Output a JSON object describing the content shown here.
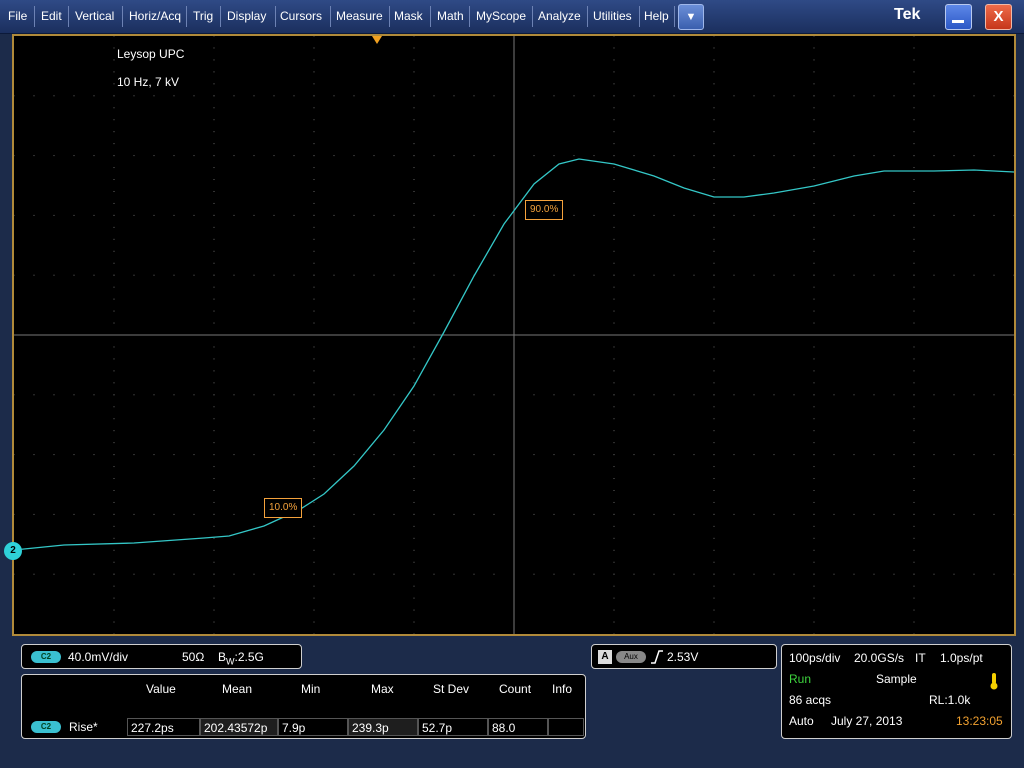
{
  "menu": {
    "items": [
      "File",
      "Edit",
      "Vertical",
      "Horiz/Acq",
      "Trig",
      "Display",
      "Cursors",
      "Measure",
      "Mask",
      "Math",
      "MyScope",
      "Analyze",
      "Utilities",
      "Help"
    ],
    "brand": "Tek"
  },
  "display": {
    "title": "Leysop UPC",
    "subtitle": "10 Hz, 7 kV",
    "channel_marker": "2",
    "label_low": "10.0%",
    "label_high": "90.0%",
    "trace_color": "#34c7c7"
  },
  "channel_panel": {
    "chip": "C2",
    "scale": "40.0mV/div",
    "termination": "50Ω",
    "bw_prefix": "B",
    "bw_sub": "W",
    "bw_value": ":2.5G"
  },
  "trigger_panel": {
    "source": "A",
    "aux": "Aux",
    "level": "2.53V"
  },
  "measurements": {
    "headers": [
      "Value",
      "Mean",
      "Min",
      "Max",
      "St Dev",
      "Count",
      "Info"
    ],
    "row": {
      "chip": "C2",
      "name": "Rise*",
      "value": "227.2ps",
      "mean": "202.43572p",
      "min": "7.9p",
      "max": "239.3p",
      "stdev": "52.7p",
      "count": "88.0",
      "info": ""
    }
  },
  "acq_panel": {
    "timebase": "100ps/div",
    "rate": "20.0GS/s",
    "mode_it": "IT",
    "resolution": "1.0ps/pt",
    "state": "Run",
    "acq_mode": "Sample",
    "acqs": "86 acqs",
    "record_length": "RL:1.0k",
    "trig_mode": "Auto",
    "date": "July 27, 2013",
    "time": "13:23:05"
  }
}
